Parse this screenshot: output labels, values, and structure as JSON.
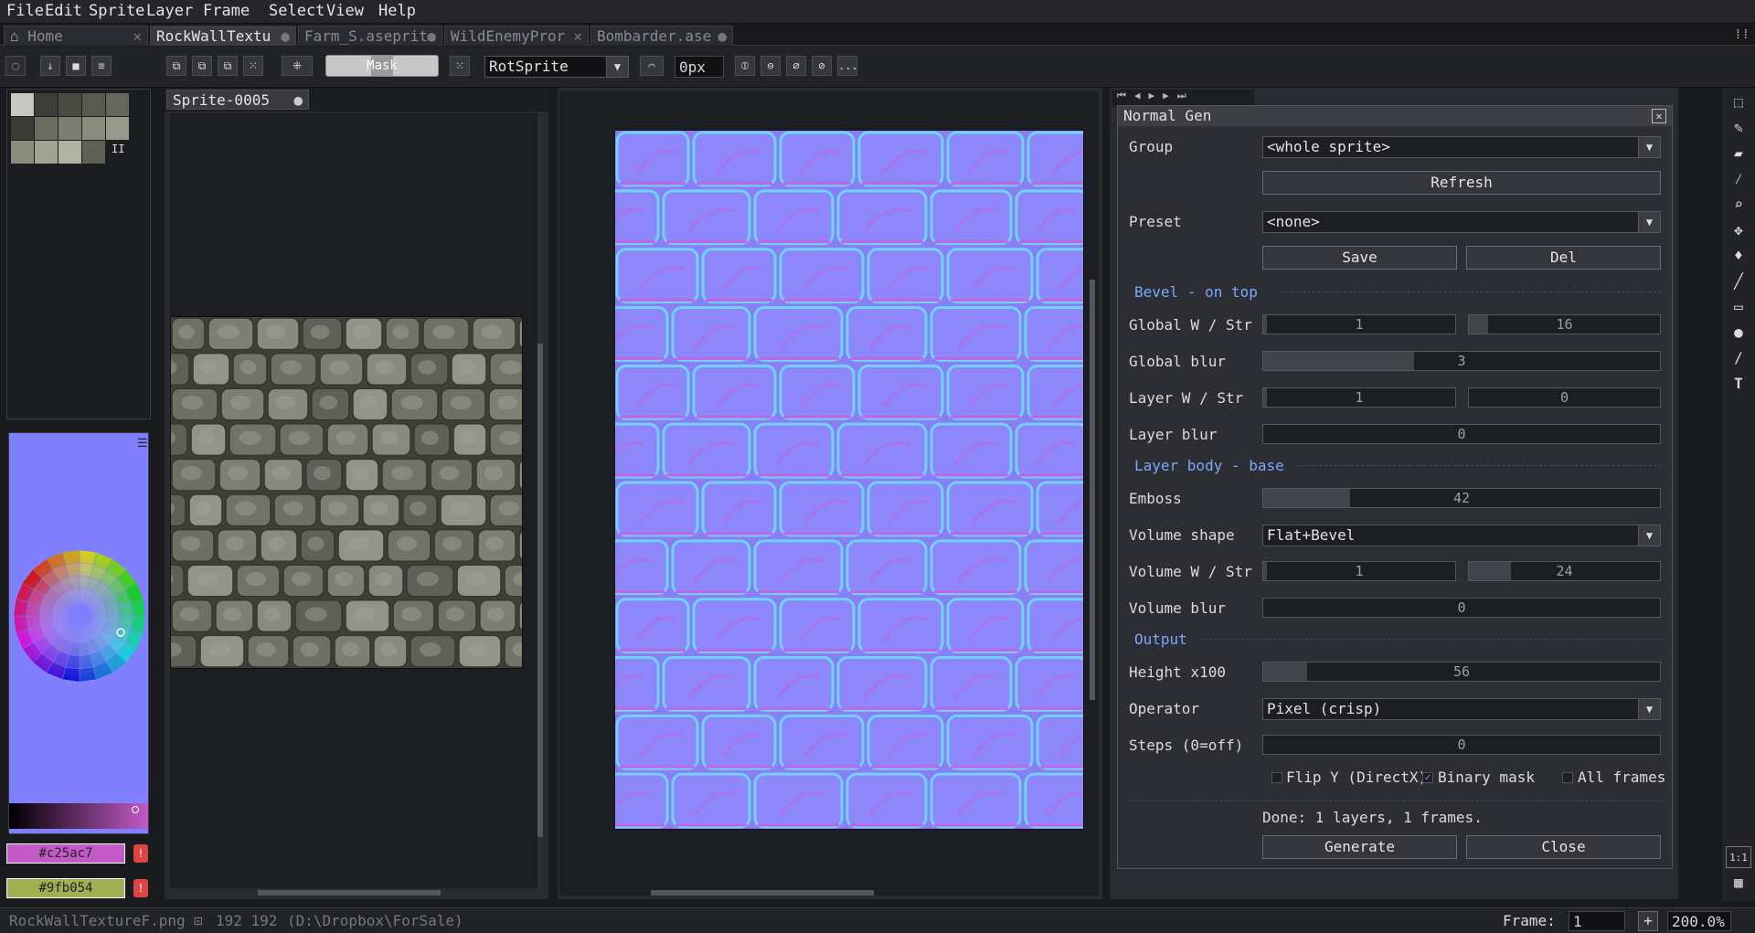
{
  "menu": [
    "File",
    "Edit",
    "Sprite",
    "Layer",
    "Frame",
    "Select",
    "View",
    "Help"
  ],
  "tabs": [
    {
      "label": "Home",
      "close": "✕"
    },
    {
      "label": "RockWallTextu",
      "close": "●"
    },
    {
      "label": "Farm_S.aseprit",
      "close": "●"
    },
    {
      "label": "WildEnemyPror",
      "close": "✕"
    },
    {
      "label": "Bombarder.ase",
      "close": "●"
    }
  ],
  "toolbar": {
    "mask_label": "Mask",
    "resize_method": "RotSprite",
    "px_value": "0px",
    "more_label": "..."
  },
  "preview_tab": "Sprite-0005",
  "colors": {
    "fg_hex": "#c25ac7",
    "bg_hex": "#9fb054",
    "fg": "#c25ac7",
    "bg": "#9fb054",
    "accent": "#7aa7ff",
    "normal_map": "#8080ff"
  },
  "dialog": {
    "title": "Normal Gen",
    "group_label": "Group",
    "group_value": "<whole sprite>",
    "refresh": "Refresh",
    "preset_label": "Preset",
    "preset_value": "<none>",
    "save": "Save",
    "del": "Del",
    "section_bevel": "Bevel - on top",
    "global_ws_label": "Global W / Str",
    "global_w": "1",
    "global_str": "16",
    "global_blur_label": "Global blur",
    "global_blur": "3",
    "layer_ws_label": "Layer W / Str",
    "layer_w": "1",
    "layer_str": "0",
    "layer_blur_label": "Layer blur",
    "layer_blur": "0",
    "section_body": "Layer body - base",
    "emboss_label": "Emboss",
    "emboss": "42",
    "volume_shape_label": "Volume shape",
    "volume_shape": "Flat+Bevel",
    "volume_ws_label": "Volume W / Str",
    "volume_w": "1",
    "volume_str": "24",
    "volume_blur_label": "Volume blur",
    "volume_blur": "0",
    "section_output": "Output",
    "height_label": "Height x100",
    "height": "56",
    "operator_label": "Operator",
    "operator": "Pixel (crisp)",
    "steps_label": "Steps (0=off)",
    "steps": "0",
    "flip_y_label": "Flip Y (DirectX)",
    "flip_y": false,
    "binary_mask_label": "Binary mask",
    "binary_mask": true,
    "all_frames_label": "All frames",
    "all_frames": false,
    "status": "Done: 1 layers, 1 frames.",
    "generate": "Generate",
    "close": "Close"
  },
  "status_bar": {
    "filename": "RockWallTextureF.png",
    "size": "192 192",
    "path": "(D:\\Dropbox\\ForSale)",
    "frame_label": "Frame:",
    "frame_value": "1",
    "add": "+",
    "zoom": "200.0%"
  },
  "right_tools_bottom": "1:1"
}
